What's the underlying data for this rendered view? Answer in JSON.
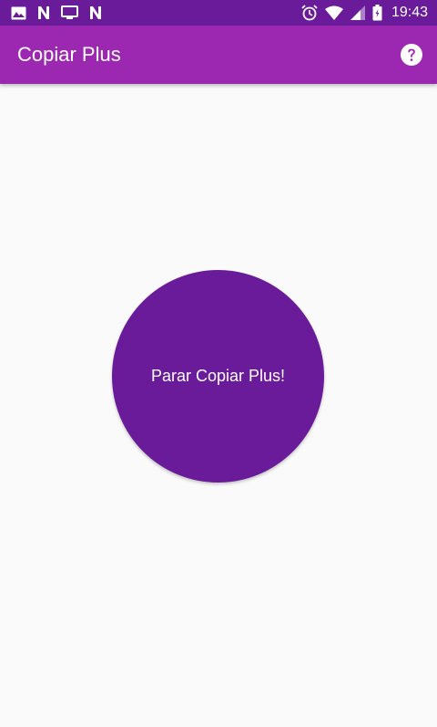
{
  "status_bar": {
    "left_icons": [
      "image-icon",
      "n-notification-icon",
      "tv-icon",
      "n-notification-icon"
    ],
    "right_icons": [
      "alarm-icon",
      "wifi-icon",
      "signal-icon",
      "battery-icon"
    ],
    "time": "19:43"
  },
  "app_bar": {
    "title": "Copiar Plus",
    "help_icon": "help-icon"
  },
  "main": {
    "toggle_label": "Parar Copiar Plus!"
  },
  "colors": {
    "status_bar": "#6a1b9a",
    "app_bar": "#9c27b0",
    "button": "#6a1b9a",
    "background": "#fafafa"
  }
}
